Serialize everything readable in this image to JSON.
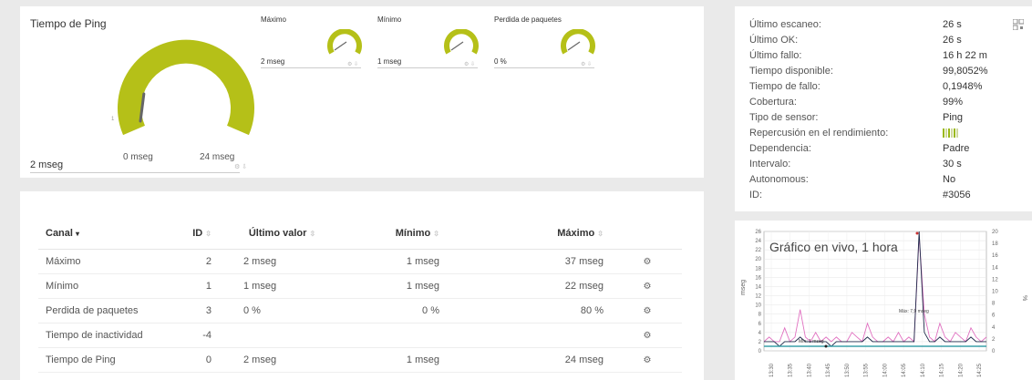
{
  "ping": {
    "title": "Tiempo de Ping",
    "value": "2 mseg",
    "gauge_min": "0 mseg",
    "gauge_max": "24 mseg",
    "gauge_fraction": 0.083
  },
  "minis": [
    {
      "label": "Máximo",
      "value": "2 mseg",
      "fraction": 0.35
    },
    {
      "label": "Mínimo",
      "value": "1 mseg",
      "fraction": 0.3
    },
    {
      "label": "Perdida de paquetes",
      "value": "0 %",
      "fraction": 0.1
    }
  ],
  "table": {
    "headers": {
      "canal": "Canal",
      "id": "ID",
      "last": "Último valor",
      "min": "Mínimo",
      "max": "Máximo"
    },
    "rows": [
      {
        "canal": "Máximo",
        "id": "2",
        "last": "2 mseg",
        "min": "1 mseg",
        "max": "37 mseg"
      },
      {
        "canal": "Mínimo",
        "id": "1",
        "last": "1 mseg",
        "min": "1 mseg",
        "max": "22 mseg"
      },
      {
        "canal": "Perdida de paquetes",
        "id": "3",
        "last": "0 %",
        "min": "0 %",
        "max": "80 %"
      },
      {
        "canal": "Tiempo de inactividad",
        "id": "-4",
        "last": "",
        "min": "",
        "max": ""
      },
      {
        "canal": "Tiempo de Ping",
        "id": "0",
        "last": "2 mseg",
        "min": "1 mseg",
        "max": "24 mseg"
      }
    ]
  },
  "info": [
    {
      "label": "Último escaneo:",
      "value": "26 s"
    },
    {
      "label": "Último OK:",
      "value": "26 s"
    },
    {
      "label": "Último fallo:",
      "value": "16 h 22 m"
    },
    {
      "label": "Tiempo disponible:",
      "value": "99,8052%"
    },
    {
      "label": "Tiempo de fallo:",
      "value": "0,1948%"
    },
    {
      "label": "Cobertura:",
      "value": "99%"
    },
    {
      "label": "Tipo de sensor:",
      "value": "Ping"
    },
    {
      "label": "Repercusión en el rendimiento:",
      "value": ""
    },
    {
      "label": "Dependencia:",
      "value": "Padre"
    },
    {
      "label": "Intervalo:",
      "value": "30 s"
    },
    {
      "label": "Autonomous:",
      "value": "No"
    },
    {
      "label": "ID:",
      "value": "#3056"
    }
  ],
  "colors": {
    "gauge": "#b5c018",
    "pink": "#e070c0",
    "navy": "#1e2b4a",
    "teal": "#3aa0a8"
  },
  "chart_data": {
    "type": "line",
    "title": "Gráfico en vivo, 1 hora",
    "ylabel": "mseg",
    "y2label": "%",
    "ylim": [
      0,
      26
    ],
    "y2lim": [
      0,
      20
    ],
    "yticks": [
      "26",
      "24",
      "22",
      "20",
      "18",
      "16",
      "14",
      "12",
      "10",
      "8",
      "6",
      "4",
      "2",
      "0"
    ],
    "y2ticks": [
      "20",
      "18",
      "16",
      "14",
      "12",
      "10",
      "8",
      "6",
      "4",
      "2",
      "0"
    ],
    "xticks": [
      "13:30",
      "13:35",
      "13:40",
      "13:45",
      "13:50",
      "13:55",
      "14:00",
      "14:05",
      "14:10",
      "14:15",
      "14:20",
      "14:25"
    ],
    "annotation_max": "Máx: 7,9 mseg",
    "annotation_min": "Mín: 1 mseg",
    "series": [
      {
        "values": [
          2,
          3,
          2,
          2,
          5,
          2,
          3,
          9,
          3,
          2,
          4,
          2,
          3,
          2,
          3,
          2,
          2,
          4,
          3,
          2,
          6,
          3,
          2,
          2,
          3,
          2,
          4,
          2,
          3,
          2,
          25,
          8,
          3,
          2,
          6,
          3,
          2,
          4,
          3,
          2,
          5,
          3,
          2,
          3
        ]
      },
      {
        "values": [
          2,
          2,
          2,
          1,
          2,
          2,
          2,
          3,
          2,
          2,
          2,
          2,
          2,
          1,
          2,
          2,
          2,
          2,
          2,
          2,
          3,
          2,
          2,
          2,
          2,
          2,
          2,
          2,
          2,
          2,
          26,
          4,
          2,
          2,
          3,
          2,
          2,
          2,
          2,
          2,
          3,
          2,
          2,
          2
        ]
      },
      {
        "values": [
          1,
          1,
          1,
          1,
          1,
          1,
          1,
          1,
          1,
          1,
          1,
          1,
          1,
          1,
          1,
          1,
          1,
          1,
          1,
          1,
          1,
          1,
          1,
          1,
          1,
          1,
          1,
          1,
          1,
          1,
          1,
          1,
          1,
          1,
          1,
          1,
          1,
          1,
          1,
          1,
          1,
          1,
          1,
          1
        ]
      }
    ]
  }
}
